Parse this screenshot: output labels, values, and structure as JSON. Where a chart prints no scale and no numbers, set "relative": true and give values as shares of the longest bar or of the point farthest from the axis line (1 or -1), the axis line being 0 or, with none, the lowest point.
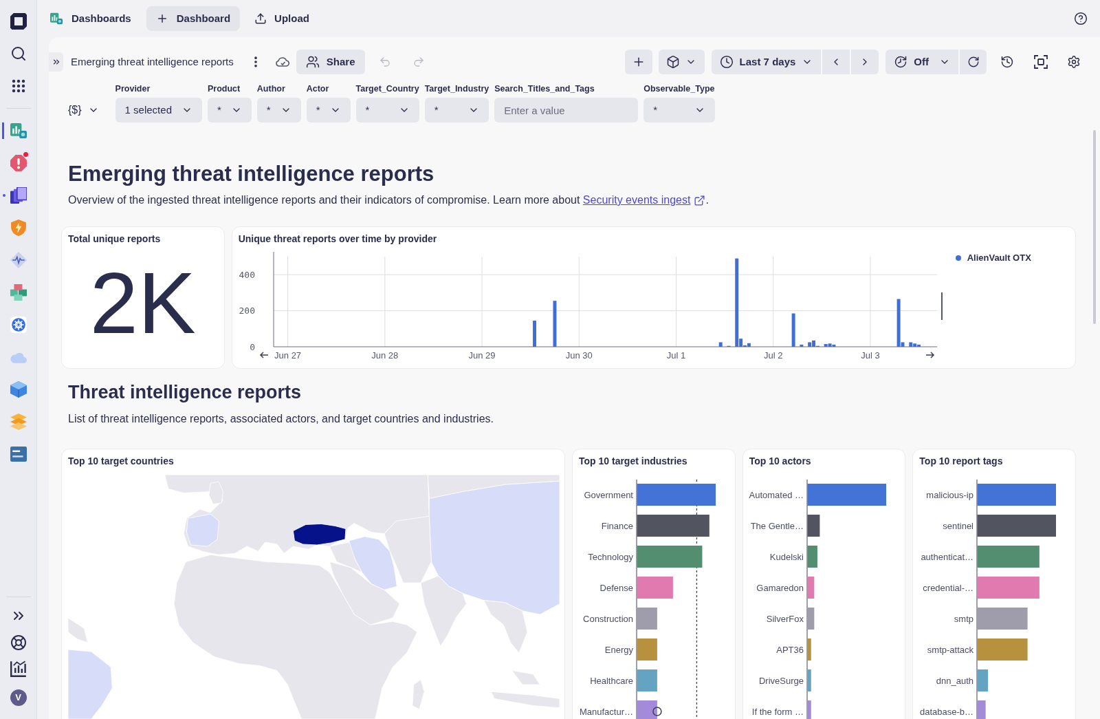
{
  "app_sidebar": {
    "apps": [
      {
        "selected": true,
        "running": false,
        "notification": false
      },
      {
        "selected": false,
        "running": false,
        "notification": true
      },
      {
        "selected": false,
        "running": true,
        "notification": false
      },
      {
        "selected": false,
        "running": false,
        "notification": false
      },
      {
        "selected": false,
        "running": false,
        "notification": false
      },
      {
        "selected": false,
        "running": false,
        "notification": false
      },
      {
        "selected": false,
        "running": false,
        "notification": false
      },
      {
        "selected": false,
        "running": false,
        "notification": false
      },
      {
        "selected": false,
        "running": false,
        "notification": false
      },
      {
        "selected": false,
        "running": false,
        "notification": false
      },
      {
        "selected": false,
        "running": false,
        "notification": false
      }
    ],
    "user_initial": "V"
  },
  "top_bar": {
    "app_name": "Dashboards",
    "actions": [
      {
        "kind": "add",
        "label": "Dashboard"
      },
      {
        "kind": "upload",
        "label": "Upload"
      }
    ]
  },
  "toolbar": {
    "title": "Emerging threat intelligence reports",
    "share": "Share",
    "undo": {
      "disabled": true
    },
    "redo": {
      "disabled": true
    },
    "timeframe": "Last 7 days",
    "auto_refresh": "Off"
  },
  "filters": {
    "variables_button": "{$}",
    "items": [
      {
        "label": "Provider",
        "kind": "select",
        "value": "1 selected"
      },
      {
        "label": "Product",
        "kind": "select",
        "value": "*"
      },
      {
        "label": "Author",
        "kind": "select",
        "value": "*"
      },
      {
        "label": "Actor",
        "kind": "select",
        "value": "*"
      },
      {
        "label": "Target_Country",
        "kind": "select",
        "value": "*"
      },
      {
        "label": "Target_Industry",
        "kind": "select",
        "value": "*"
      },
      {
        "label": "Search_Titles_and_Tags",
        "kind": "text",
        "placeholder": "Enter a value"
      },
      {
        "label": "Observable_Type",
        "kind": "select",
        "value": "*"
      }
    ]
  },
  "overview": {
    "title": "Emerging threat intelligence reports",
    "description": "Overview of the ingested threat intelligence reports and their indicators of compromise. Learn more about",
    "link": "Security events ingest",
    "description_end": "."
  },
  "summary_tiles": [
    {
      "kind": "single_value",
      "title": "Total unique reports",
      "value": "2K"
    },
    {
      "kind": "timeseries",
      "title": "Unique threat reports over time by provider",
      "chart_data": {
        "type": "bar",
        "categories": [
          null,
          null,
          null,
          "Jun 27",
          null,
          null,
          null,
          null,
          null,
          null,
          null,
          null,
          null,
          null,
          null,
          null,
          null,
          null,
          null,
          null,
          null,
          null,
          null,
          null,
          null,
          null,
          null,
          "Jun 28",
          null,
          null,
          null,
          null,
          null,
          null,
          null,
          null,
          null,
          null,
          null,
          null,
          null,
          null,
          null,
          null,
          null,
          null,
          null,
          null,
          null,
          null,
          null,
          "Jun 29",
          null,
          null,
          null,
          null,
          null,
          null,
          null,
          null,
          null,
          null,
          null,
          null,
          null,
          null,
          null,
          null,
          null,
          null,
          null,
          null,
          null,
          null,
          null,
          "Jun 30",
          null,
          null,
          null,
          null,
          null,
          null,
          null,
          null,
          null,
          null,
          null,
          null,
          null,
          null,
          null,
          null,
          null,
          null,
          null,
          null,
          null,
          null,
          null,
          "Jul 1",
          null,
          null,
          null,
          null,
          null,
          null,
          null,
          null,
          null,
          null,
          null,
          null,
          null,
          null,
          null,
          null,
          null,
          null,
          null,
          null,
          null,
          null,
          null,
          "Jul 2",
          null,
          null,
          null,
          null,
          null,
          null,
          null,
          null,
          null,
          null,
          null,
          null,
          null,
          null,
          null,
          null,
          null,
          null,
          null,
          null,
          null,
          null,
          null,
          "Jul 3",
          null,
          null,
          null,
          null,
          null,
          null,
          null,
          null,
          null,
          null,
          null,
          null,
          null,
          null,
          null,
          null
        ],
        "series": [
          {
            "name": "AlienVault OTX",
            "color": "#3f6fd6",
            "values": [
              0,
              0,
              0,
              0,
              0,
              0,
              0,
              0,
              0,
              0,
              0,
              0,
              0,
              0,
              0,
              0,
              0,
              0,
              0,
              0,
              0,
              0,
              0,
              0,
              0,
              0,
              0,
              0,
              0,
              0,
              0,
              0,
              0,
              0,
              0,
              0,
              0,
              0,
              0,
              0,
              0,
              0,
              0,
              0,
              0,
              0,
              0,
              0,
              0,
              0,
              0,
              0,
              0,
              0,
              0,
              0,
              0,
              0,
              0,
              0,
              0,
              0,
              0,
              0,
              145,
              0,
              0,
              0,
              0,
              255,
              0,
              0,
              0,
              0,
              0,
              0,
              0,
              0,
              0,
              0,
              0,
              0,
              0,
              0,
              0,
              0,
              0,
              0,
              0,
              0,
              0,
              0,
              0,
              0,
              0,
              0,
              0,
              0,
              0,
              0,
              0,
              0,
              0,
              0,
              0,
              0,
              0,
              0,
              0,
              0,
              25,
              0,
              5,
              0,
              490,
              45,
              8,
              20,
              0,
              0,
              0,
              0,
              0,
              0,
              0,
              0,
              0,
              0,
              185,
              0,
              12,
              0,
              25,
              35,
              5,
              0,
              15,
              18,
              12,
              0,
              0,
              0,
              0,
              0,
              0,
              0,
              0,
              0,
              0,
              0,
              0,
              0,
              0,
              0,
              265,
              25,
              0,
              25,
              18,
              12,
              0,
              0,
              0,
              0
            ]
          }
        ],
        "ylim": [
          0,
          500
        ],
        "yticks": [
          0,
          200,
          400
        ]
      }
    }
  ],
  "reports_section": {
    "title": "Threat intelligence reports",
    "description": "List of threat intelligence reports, associated actors, and target countries and industries."
  },
  "detail_tiles": [
    {
      "kind": "map",
      "title": "Top 10 target countries"
    },
    {
      "kind": "bar",
      "title": "Top 10 target industries",
      "chart_data": {
        "type": "bar",
        "orientation": "horizontal",
        "relative": true,
        "categories": [
          "Government",
          "Finance",
          "Technology",
          "Defense",
          "Construction",
          "Energy",
          "Healthcare",
          "Manufactur…"
        ],
        "values": [
          1,
          0.92,
          0.83,
          0.46,
          0.26,
          0.26,
          0.26,
          0.26
        ],
        "ref_lines": [
          {
            "axis": "x",
            "value": 0.76
          }
        ]
      },
      "hovered_bars": [
        false,
        false,
        false,
        false,
        false,
        false,
        false,
        true
      ]
    },
    {
      "kind": "bar",
      "title": "Top 10 actors",
      "chart_data": {
        "type": "bar",
        "orientation": "horizontal",
        "relative": true,
        "categories": [
          "Automated …",
          "The Gentle…",
          "Kudelski",
          "Gamaredon",
          "SilverFox",
          "APT36",
          "DriveSurge",
          "If the form …"
        ],
        "values": [
          1,
          0.16,
          0.13,
          0.09,
          0.09,
          0.05,
          0.05,
          0.05
        ]
      }
    },
    {
      "kind": "bar",
      "title": "Top 10 report tags",
      "chart_data": {
        "type": "bar",
        "orientation": "horizontal",
        "relative": true,
        "categories": [
          "malicious-ip",
          "sentinel",
          "authenticat…",
          "credential-…",
          "smtp",
          "smtp-attack",
          "dnn_auth",
          "database-b…"
        ],
        "values": [
          1,
          1,
          0.79,
          0.79,
          0.64,
          0.64,
          0.14,
          0.11
        ]
      }
    }
  ]
}
